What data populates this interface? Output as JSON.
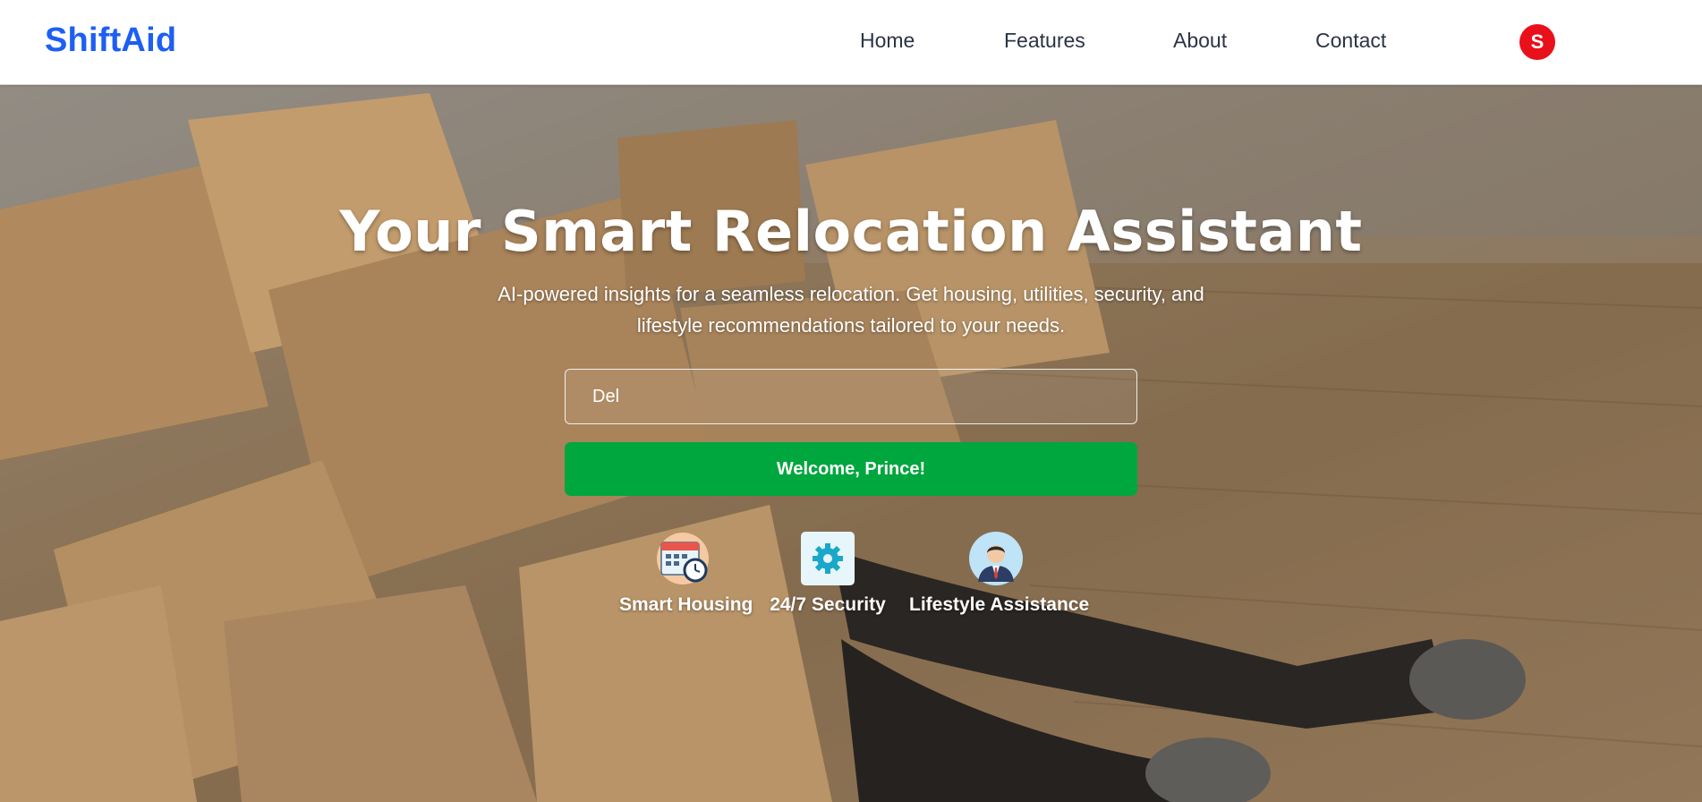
{
  "brand": {
    "name": "ShiftAid",
    "color": "#1d5ff2"
  },
  "nav": {
    "links": [
      {
        "label": "Home"
      },
      {
        "label": "Features"
      },
      {
        "label": "About"
      },
      {
        "label": "Contact"
      }
    ],
    "avatar_initial": "S",
    "avatar_color": "#e8101b"
  },
  "hero": {
    "title": "Your Smart Relocation Assistant",
    "subtitle": "AI-powered insights for a seamless relocation. Get housing, utilities, security, and lifestyle recommendations tailored to your needs.",
    "background_image": "moving-boxes-photo",
    "location_input": {
      "value": "Del"
    },
    "welcome_button": {
      "label": "Welcome, Prince!",
      "color": "#00a63e"
    },
    "features": [
      {
        "label": "Smart Housing",
        "icon": "calendar-clock-icon"
      },
      {
        "label": "24/7 Security",
        "icon": "gear-icon"
      },
      {
        "label": "Lifestyle Assistance",
        "icon": "businessman-avatar-icon"
      }
    ]
  }
}
